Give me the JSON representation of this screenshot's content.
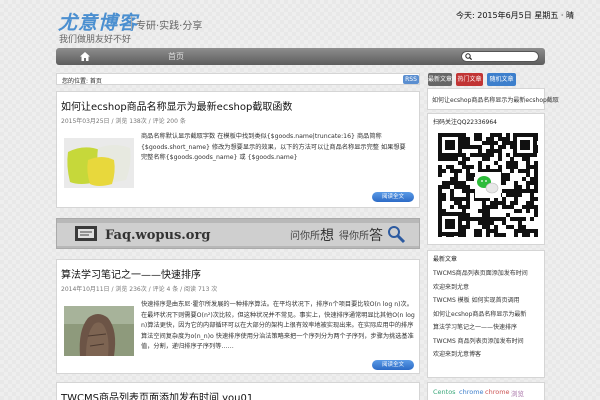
{
  "header": {
    "logo_text": "尤意博客",
    "tagline": "专研·实践·分享",
    "subtitle": "我们做朋友好不好",
    "date": "今天: 2015年6月5日 星期五 · 晴"
  },
  "nav": {
    "home_icon": "home-icon",
    "item": "首页",
    "search_placeholder": "",
    "search_icon": "search-icon"
  },
  "breadcrumb": {
    "text": "您的位置: 首页",
    "rss": "RSS"
  },
  "posts": [
    {
      "title": "如何让ecshop商品名称显示为最新ecshop截取函数",
      "meta": "2015年03月25日 / 浏览 138次 / 评论 200 条",
      "excerpt": "商品名称默认显示截取字数 在模板中找到类似{$goods.name|truncate:16} 商品简称{$goods.short_name} 修改为想要显示的效果，以下的方法可以让商品名称显示完整   如果想要 完整名称{$goods.goods_name} 或 {$goods.name}",
      "read_more": "阅读全文",
      "image": "pillows-photo"
    },
    {
      "title": "算法学习笔记之一——快速排序",
      "meta": "2014年10月11日 / 浏览 236次 / 评论 4 条 / 阅读 713 次",
      "excerpt": "快速排序是由东尼·霍尔所发展的一种排序算法。在平均状况下，排序n个项目要比较O(n log n)次。在最坏状况下则需要O(n²)次比较，但这种状况并不常见。事实上，快速排序通常明显比其他O(n log n)算法更快，因为它的内部循环可以在大部分的架构上很有效率地被实现出来。在实际应用中的排序算法空间复杂度为o(n_n)o 快速排序使用分治法策略来把一个序列分为两个子序列，步骤为挑选基准值，分割，递归排序子序列等……",
      "read_more": "阅读全文",
      "image": "tree-bark-photo"
    },
    {
      "title": "TWCMS商品列表页面添加发布时间 you01",
      "meta": "",
      "excerpt": "",
      "read_more": "",
      "image": ""
    }
  ],
  "ad_banner": {
    "domain": "Faq.wopus.org",
    "slogan": "问你所",
    "slogan_big1": "想",
    "slogan_mid": "得你所",
    "slogan_big2": "答",
    "icon": "magnifier-icon"
  },
  "sidebar": {
    "tabs": [
      "最新文章",
      "热门文章",
      "随机文章"
    ],
    "tab_text": "如何让ecshop商品名称显示为最新ecshop截取",
    "qq_title": "扫码关注QQ22336964",
    "recent_title": "最新文章",
    "recent_items": [
      "TWCMS商品列表页面添加发布时间",
      "欢迎来到尤意",
      "TWCMS 模板 如何实现首页调用",
      "如何让ecshop商品名称显示为最新",
      "算法学习笔记之一——快速排序",
      "TWCMS 商品列表页添加发布时间",
      "欢迎来到尤意博客"
    ],
    "tags": [
      {
        "text": "Centos",
        "color": "#3aa87a"
      },
      {
        "text": "chrome",
        "color": "#3d7fcc"
      },
      {
        "text": "chrome",
        "color": "#c55"
      },
      {
        "text": "浏览",
        "color": "#a7a"
      }
    ]
  },
  "colors": {
    "accent": "#4b8fd0",
    "nav_bg": "#6e6e6e",
    "button": "#3a7ad6",
    "tab_red": "#c13434",
    "tab_blue": "#3d7fcc"
  }
}
